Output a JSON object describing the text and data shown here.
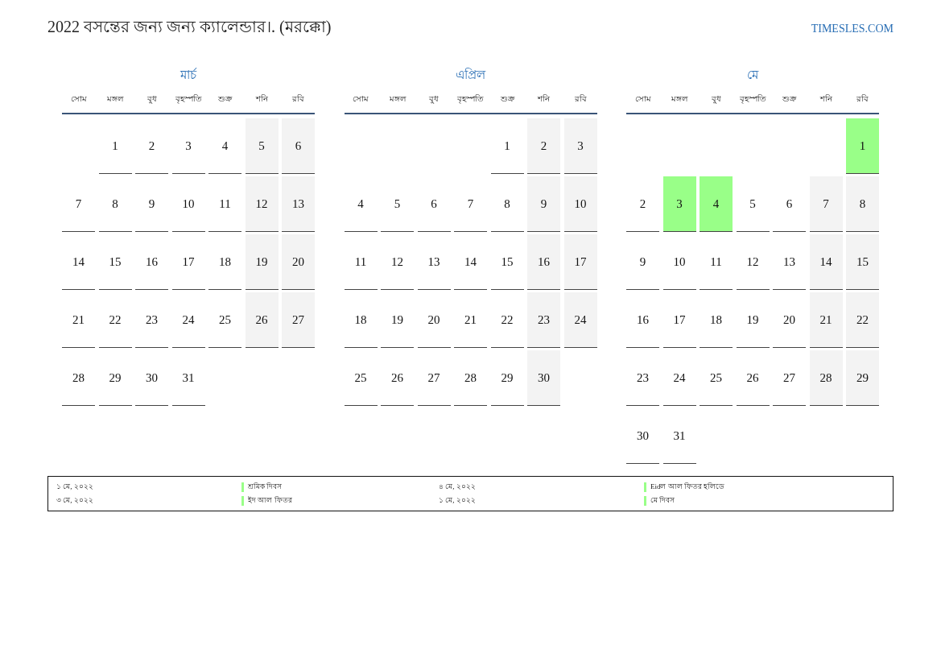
{
  "title": "2022 বসন্তের জন্য জন্য ক্যালেন্ডার।. (মরক্কো)",
  "site": "TIMESLES.COM",
  "months": [
    {
      "name": "মার্চ",
      "weekdays": [
        "সোম",
        "মঙ্গল",
        "বুধ",
        "বৃহস্পতি",
        "শুক্র",
        "শনি",
        "রবি"
      ],
      "weeks": [
        [
          {
            "kind": "blank"
          },
          {
            "kind": "day",
            "d": "1",
            "holiday": false
          },
          {
            "kind": "day",
            "d": "2",
            "holiday": false
          },
          {
            "kind": "day",
            "d": "3",
            "holiday": false
          },
          {
            "kind": "day",
            "d": "4",
            "holiday": false
          },
          {
            "kind": "day",
            "d": "5",
            "holiday": false
          },
          {
            "kind": "day",
            "d": "6",
            "holiday": false
          }
        ],
        [
          {
            "kind": "day",
            "d": "7",
            "holiday": false
          },
          {
            "kind": "day",
            "d": "8",
            "holiday": false
          },
          {
            "kind": "day",
            "d": "9",
            "holiday": false
          },
          {
            "kind": "day",
            "d": "10",
            "holiday": false
          },
          {
            "kind": "day",
            "d": "11",
            "holiday": false
          },
          {
            "kind": "day",
            "d": "12",
            "holiday": false
          },
          {
            "kind": "day",
            "d": "13",
            "holiday": false
          }
        ],
        [
          {
            "kind": "day",
            "d": "14",
            "holiday": false
          },
          {
            "kind": "day",
            "d": "15",
            "holiday": false
          },
          {
            "kind": "day",
            "d": "16",
            "holiday": false
          },
          {
            "kind": "day",
            "d": "17",
            "holiday": false
          },
          {
            "kind": "day",
            "d": "18",
            "holiday": false
          },
          {
            "kind": "day",
            "d": "19",
            "holiday": false
          },
          {
            "kind": "day",
            "d": "20",
            "holiday": false
          }
        ],
        [
          {
            "kind": "day",
            "d": "21",
            "holiday": false
          },
          {
            "kind": "day",
            "d": "22",
            "holiday": false
          },
          {
            "kind": "day",
            "d": "23",
            "holiday": false
          },
          {
            "kind": "day",
            "d": "24",
            "holiday": false
          },
          {
            "kind": "day",
            "d": "25",
            "holiday": false
          },
          {
            "kind": "day",
            "d": "26",
            "holiday": false
          },
          {
            "kind": "day",
            "d": "27",
            "holiday": false
          }
        ],
        [
          {
            "kind": "day",
            "d": "28",
            "holiday": false
          },
          {
            "kind": "day",
            "d": "29",
            "holiday": false
          },
          {
            "kind": "day",
            "d": "30",
            "holiday": false
          },
          {
            "kind": "day",
            "d": "31",
            "holiday": false
          },
          {
            "kind": "blank"
          },
          {
            "kind": "blank"
          },
          {
            "kind": "blank"
          }
        ]
      ]
    },
    {
      "name": "এপ্রিল",
      "weekdays": [
        "সোম",
        "মঙ্গল",
        "বুধ",
        "বৃহস্পতি",
        "শুক্র",
        "শনি",
        "রবি"
      ],
      "weeks": [
        [
          {
            "kind": "blank"
          },
          {
            "kind": "blank"
          },
          {
            "kind": "blank"
          },
          {
            "kind": "blank"
          },
          {
            "kind": "day",
            "d": "1",
            "holiday": false
          },
          {
            "kind": "day",
            "d": "2",
            "holiday": false
          },
          {
            "kind": "day",
            "d": "3",
            "holiday": false
          }
        ],
        [
          {
            "kind": "day",
            "d": "4",
            "holiday": false
          },
          {
            "kind": "day",
            "d": "5",
            "holiday": false
          },
          {
            "kind": "day",
            "d": "6",
            "holiday": false
          },
          {
            "kind": "day",
            "d": "7",
            "holiday": false
          },
          {
            "kind": "day",
            "d": "8",
            "holiday": false
          },
          {
            "kind": "day",
            "d": "9",
            "holiday": false
          },
          {
            "kind": "day",
            "d": "10",
            "holiday": false
          }
        ],
        [
          {
            "kind": "day",
            "d": "11",
            "holiday": false
          },
          {
            "kind": "day",
            "d": "12",
            "holiday": false
          },
          {
            "kind": "day",
            "d": "13",
            "holiday": false
          },
          {
            "kind": "day",
            "d": "14",
            "holiday": false
          },
          {
            "kind": "day",
            "d": "15",
            "holiday": false
          },
          {
            "kind": "day",
            "d": "16",
            "holiday": false
          },
          {
            "kind": "day",
            "d": "17",
            "holiday": false
          }
        ],
        [
          {
            "kind": "day",
            "d": "18",
            "holiday": false
          },
          {
            "kind": "day",
            "d": "19",
            "holiday": false
          },
          {
            "kind": "day",
            "d": "20",
            "holiday": false
          },
          {
            "kind": "day",
            "d": "21",
            "holiday": false
          },
          {
            "kind": "day",
            "d": "22",
            "holiday": false
          },
          {
            "kind": "day",
            "d": "23",
            "holiday": false
          },
          {
            "kind": "day",
            "d": "24",
            "holiday": false
          }
        ],
        [
          {
            "kind": "day",
            "d": "25",
            "holiday": false
          },
          {
            "kind": "day",
            "d": "26",
            "holiday": false
          },
          {
            "kind": "day",
            "d": "27",
            "holiday": false
          },
          {
            "kind": "day",
            "d": "28",
            "holiday": false
          },
          {
            "kind": "day",
            "d": "29",
            "holiday": false
          },
          {
            "kind": "day",
            "d": "30",
            "holiday": false
          },
          {
            "kind": "blank"
          }
        ]
      ]
    },
    {
      "name": "মে",
      "weekdays": [
        "সোম",
        "মঙ্গল",
        "বুধ",
        "বৃহস্পতি",
        "শুক্র",
        "শনি",
        "রবি"
      ],
      "weeks": [
        [
          {
            "kind": "blank"
          },
          {
            "kind": "blank"
          },
          {
            "kind": "blank"
          },
          {
            "kind": "blank"
          },
          {
            "kind": "blank"
          },
          {
            "kind": "blank"
          },
          {
            "kind": "day",
            "d": "1",
            "holiday": true
          }
        ],
        [
          {
            "kind": "day",
            "d": "2",
            "holiday": false
          },
          {
            "kind": "day",
            "d": "3",
            "holiday": true
          },
          {
            "kind": "day",
            "d": "4",
            "holiday": true
          },
          {
            "kind": "day",
            "d": "5",
            "holiday": false
          },
          {
            "kind": "day",
            "d": "6",
            "holiday": false
          },
          {
            "kind": "day",
            "d": "7",
            "holiday": false
          },
          {
            "kind": "day",
            "d": "8",
            "holiday": false
          }
        ],
        [
          {
            "kind": "day",
            "d": "9",
            "holiday": false
          },
          {
            "kind": "day",
            "d": "10",
            "holiday": false
          },
          {
            "kind": "day",
            "d": "11",
            "holiday": false
          },
          {
            "kind": "day",
            "d": "12",
            "holiday": false
          },
          {
            "kind": "day",
            "d": "13",
            "holiday": false
          },
          {
            "kind": "day",
            "d": "14",
            "holiday": false
          },
          {
            "kind": "day",
            "d": "15",
            "holiday": false
          }
        ],
        [
          {
            "kind": "day",
            "d": "16",
            "holiday": false
          },
          {
            "kind": "day",
            "d": "17",
            "holiday": false
          },
          {
            "kind": "day",
            "d": "18",
            "holiday": false
          },
          {
            "kind": "day",
            "d": "19",
            "holiday": false
          },
          {
            "kind": "day",
            "d": "20",
            "holiday": false
          },
          {
            "kind": "day",
            "d": "21",
            "holiday": false
          },
          {
            "kind": "day",
            "d": "22",
            "holiday": false
          }
        ],
        [
          {
            "kind": "day",
            "d": "23",
            "holiday": false
          },
          {
            "kind": "day",
            "d": "24",
            "holiday": false
          },
          {
            "kind": "day",
            "d": "25",
            "holiday": false
          },
          {
            "kind": "day",
            "d": "26",
            "holiday": false
          },
          {
            "kind": "day",
            "d": "27",
            "holiday": false
          },
          {
            "kind": "day",
            "d": "28",
            "holiday": false
          },
          {
            "kind": "day",
            "d": "29",
            "holiday": false
          }
        ],
        [
          {
            "kind": "day",
            "d": "30",
            "holiday": false
          },
          {
            "kind": "day",
            "d": "31",
            "holiday": false
          },
          {
            "kind": "blank"
          },
          {
            "kind": "blank"
          },
          {
            "kind": "blank"
          },
          {
            "kind": "blank"
          },
          {
            "kind": "blank"
          }
        ]
      ]
    }
  ],
  "legend": [
    {
      "date": "১ মে, ২০২২",
      "name": "শ্রমিক দিবস",
      "color": "#99ff88"
    },
    {
      "date": "৪ মে, ২০২২",
      "name": "Eidল আল ফিতর হলিডে",
      "color": "#99ff88"
    },
    {
      "date": "৩ মে, ২০২২",
      "name": "ইদ আল ফিতর",
      "color": "#99ff88"
    },
    {
      "date": "১ মে, ২০২২",
      "name": "মে দিবস",
      "color": "#99ff88"
    }
  ]
}
